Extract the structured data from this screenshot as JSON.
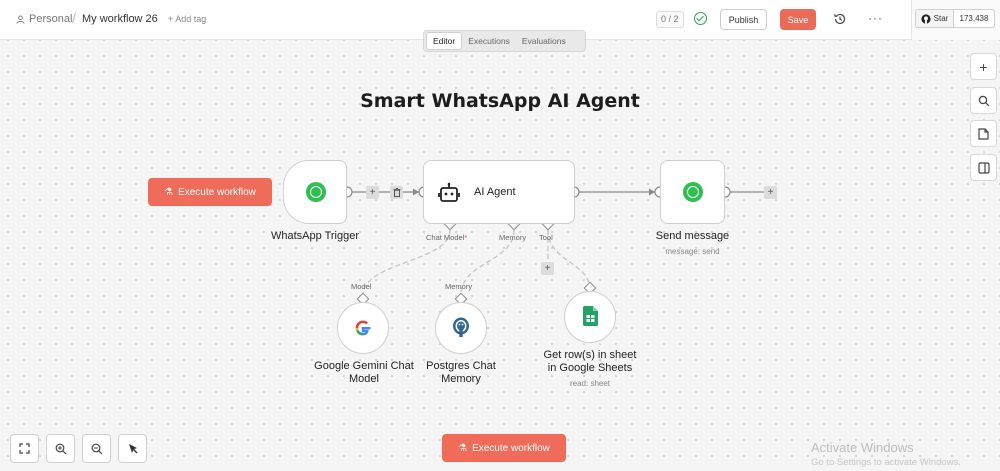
{
  "topbar": {
    "project": "Personal",
    "separator": "/",
    "workflow_name": "My workflow 26",
    "add_tag": "+ Add tag",
    "counter": "0 / 2",
    "publish_label": "Publish",
    "save_label": "Save",
    "more_label": "···",
    "github_star_label": "Star",
    "github_star_count": "173,438"
  },
  "tabs": [
    {
      "label": "Editor",
      "active": true
    },
    {
      "label": "Executions",
      "active": false
    },
    {
      "label": "Evaluations",
      "active": false
    }
  ],
  "canvas": {
    "title": "Smart WhatsApp AI Agent",
    "execute_label": "Execute workflow",
    "nodes": {
      "trigger": {
        "label": "WhatsApp Trigger"
      },
      "agent": {
        "label": "AI Agent",
        "ports": {
          "chat_model": "Chat Model",
          "required_mark": "*",
          "memory": "Memory",
          "tool": "Tool"
        }
      },
      "send": {
        "label": "Send message",
        "subtitle": "message: send"
      },
      "gemini": {
        "label_line1": "Google Gemini Chat",
        "label_line2": "Model",
        "port": "Model"
      },
      "postgres": {
        "label_line1": "Postgres Chat",
        "label_line2": "Memory",
        "port": "Memory"
      },
      "sheets": {
        "label_line1": "Get row(s) in sheet",
        "label_line2": "in Google Sheets",
        "subtitle": "read: sheet"
      }
    }
  },
  "bottom": {
    "execute_label": "Execute workflow"
  },
  "watermark": {
    "line1": "Activate Windows",
    "line2": "Go to Settings to activate Windows."
  },
  "colors": {
    "accent": "#ef6b5a",
    "whatsapp": "#2fbe4f",
    "success": "#2ca05a"
  }
}
